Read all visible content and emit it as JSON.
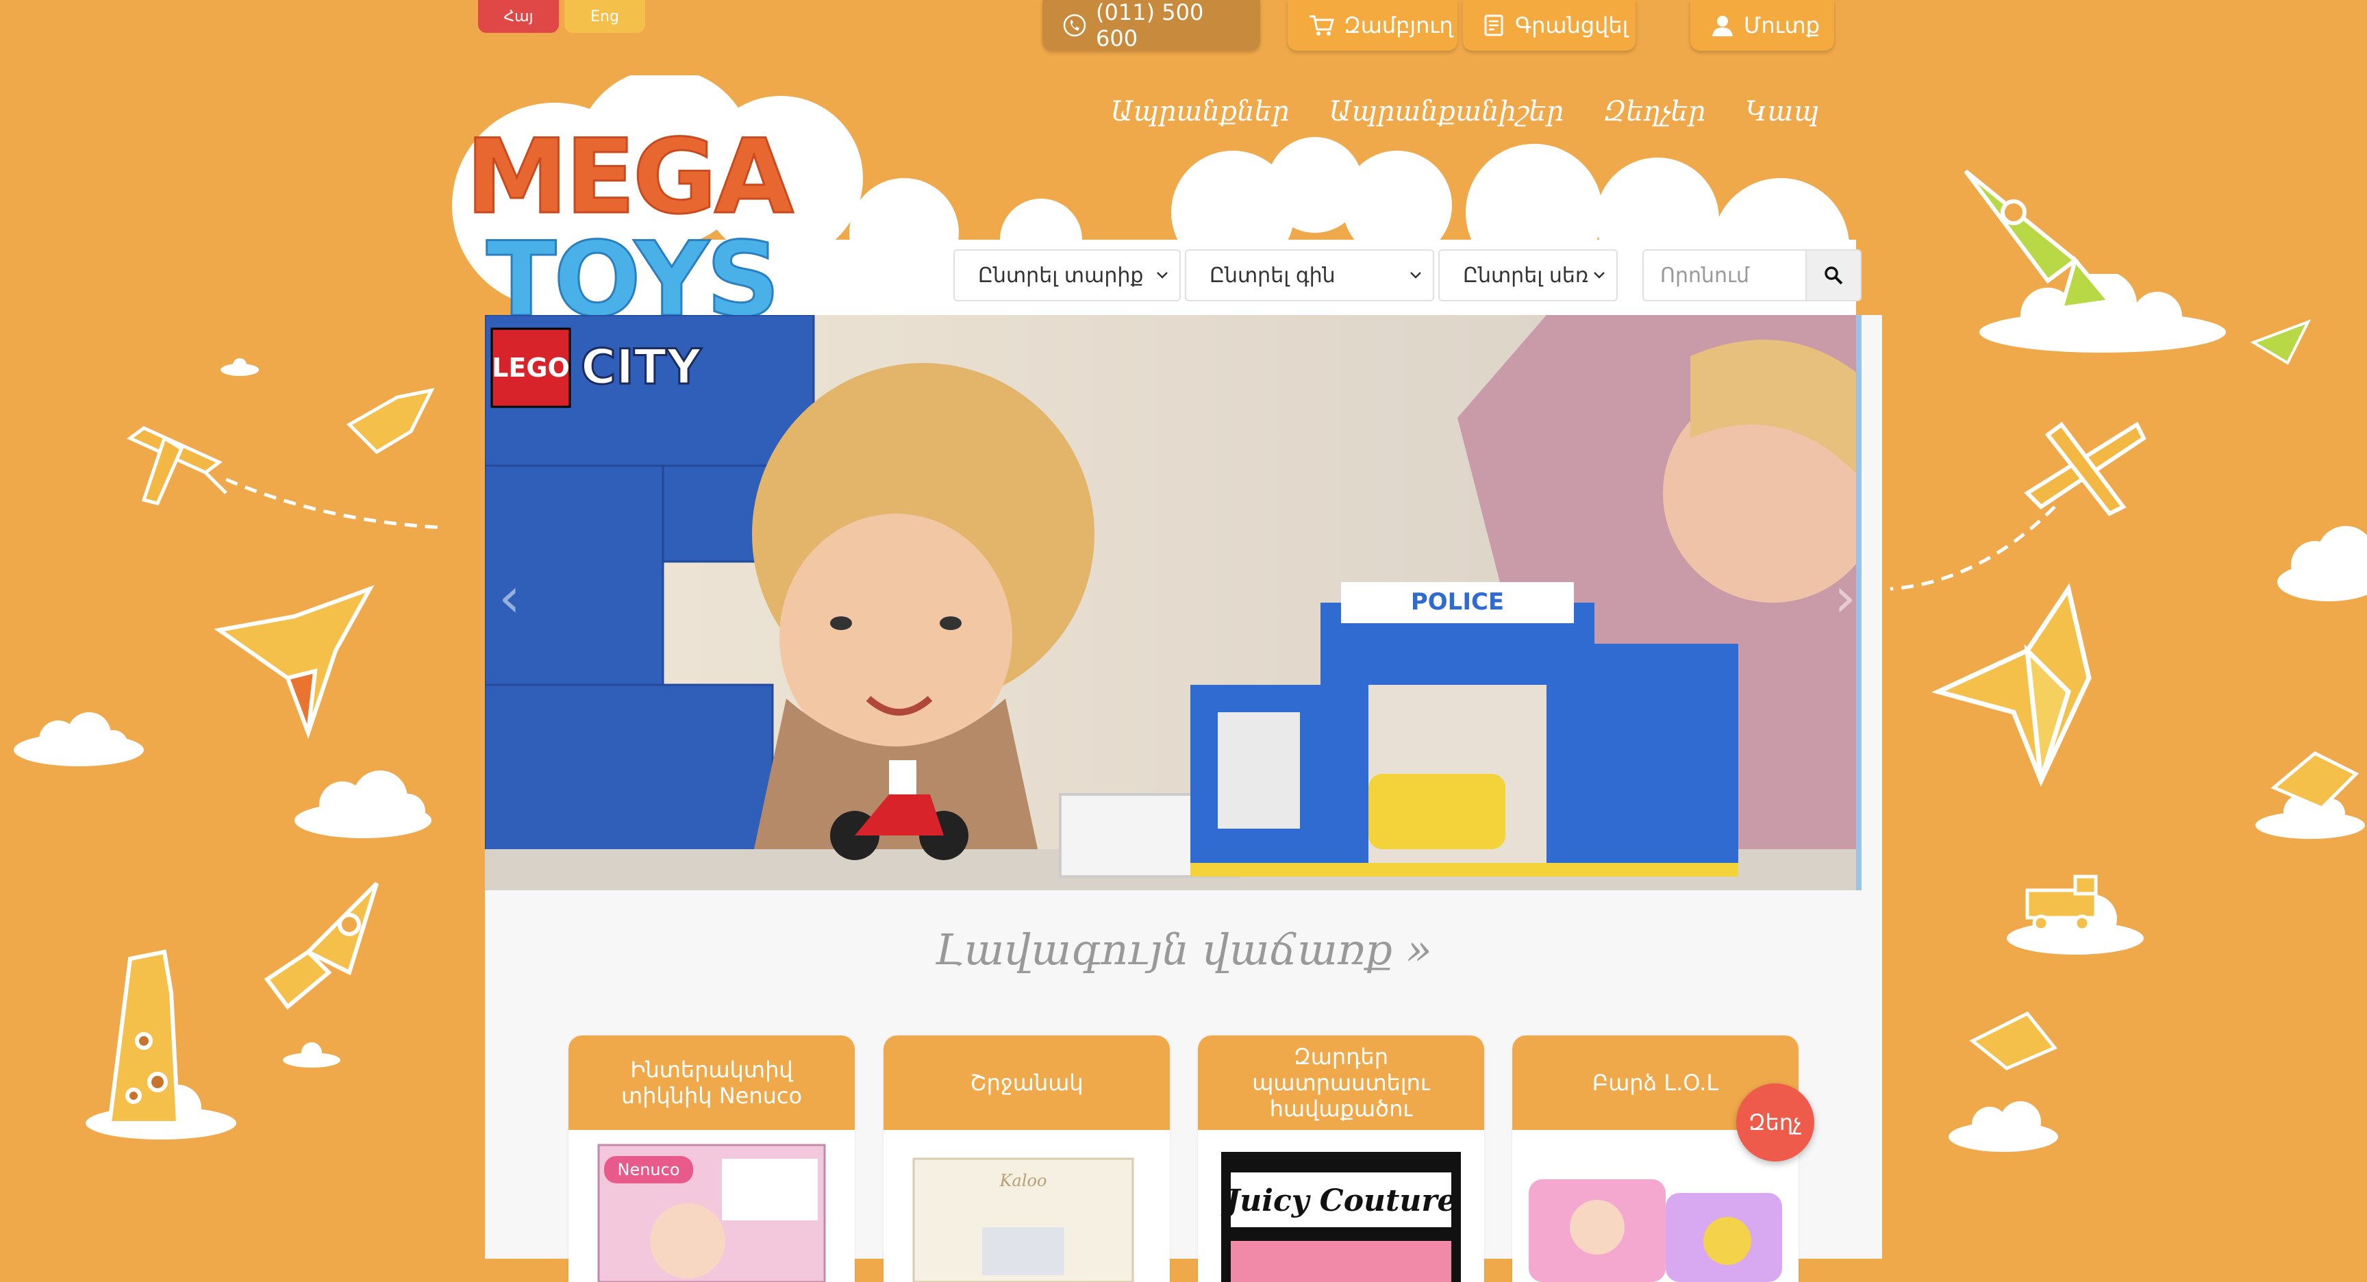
{
  "languages": [
    {
      "label": "Հայ",
      "active": true
    },
    {
      "label": "Eng",
      "active": false
    }
  ],
  "top_bar": {
    "phone": "(011) 500 600",
    "cart_label": "Զամբյուղ",
    "register_label": "Գրանցվել",
    "login_label": "Մուտք"
  },
  "nav": {
    "items": [
      "Ապրանքներ",
      "Ապրանքանիշեր",
      "Զեղչեր",
      "Կապ"
    ]
  },
  "logo": {
    "line1": "MEGA",
    "line2": "TOYS"
  },
  "filters": {
    "age": "Ընտրել տարիք",
    "price": "Ընտրել գին",
    "gender": "Ընտրել սեռ"
  },
  "search": {
    "placeholder": "Որոնում"
  },
  "banner": {
    "brand1": "LEGO",
    "brand2": "CITY",
    "sign": "POLICE"
  },
  "bestsellers": {
    "title": "Լավագույն վաճառք »",
    "products": [
      {
        "name": "Ինտերակտիվ տիկնիկ Nenuco",
        "img_label": "Nenuco"
      },
      {
        "name": "Շրջանակ",
        "img_label": "Kaloo"
      },
      {
        "name": "Զարդեր պատրաստելու հավաքածու",
        "img_label": "Juicy Couture"
      },
      {
        "name": "Բարձ L.O.L",
        "img_label": ""
      }
    ]
  },
  "chat": {
    "label": "Զեղչ"
  },
  "colors": {
    "background": "#f0a94a",
    "accent_red": "#e04848",
    "accent_yellow": "#f4c04a",
    "button_orange": "#f4aa3e",
    "phone_button": "#c88a3c"
  }
}
